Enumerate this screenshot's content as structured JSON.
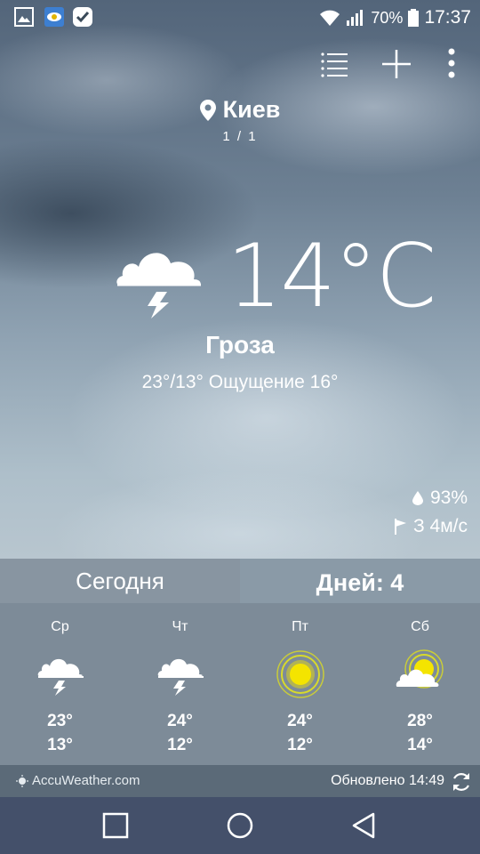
{
  "status_bar": {
    "battery_percent": "70%",
    "time": "17:37",
    "notification_icons": [
      "image-icon",
      "eye-app-icon",
      "check-app-icon"
    ]
  },
  "location": {
    "name": "Киев",
    "page_indicator": "1 / 1"
  },
  "current": {
    "temperature": "14",
    "unit": "°C",
    "condition": "Гроза",
    "hilo_feels": "23°/13° Ощущение 16°",
    "humidity": "93%",
    "wind": "З 4м/с",
    "icon": "thunderstorm-icon"
  },
  "tabs": {
    "today": "Сегодня",
    "days": "Дней: 4"
  },
  "forecast": [
    {
      "day": "Ср",
      "high": "23°",
      "low": "13°",
      "icon": "thunderstorm-icon"
    },
    {
      "day": "Чт",
      "high": "24°",
      "low": "12°",
      "icon": "thunderstorm-icon"
    },
    {
      "day": "Пт",
      "high": "24°",
      "low": "12°",
      "icon": "sunny-icon"
    },
    {
      "day": "Сб",
      "high": "28°",
      "low": "14°",
      "icon": "partly-cloudy-icon"
    }
  ],
  "footer": {
    "brand": "AccuWeather.com",
    "updated": "Обновлено 14:49"
  },
  "colors": {
    "sun": "#f4e400",
    "forecast_bg": "#7d8b98",
    "navbar": "#44506a"
  }
}
